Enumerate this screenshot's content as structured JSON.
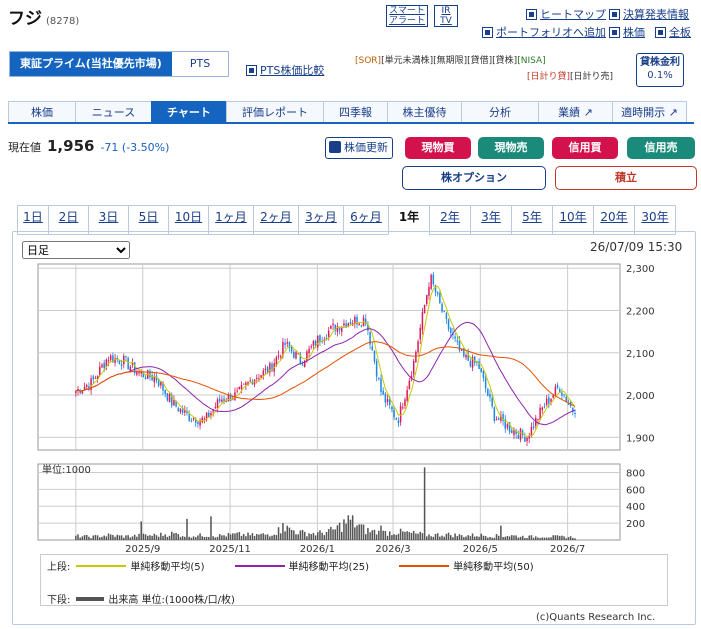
{
  "header": {
    "company": "フジ",
    "code": "(8278)"
  },
  "top_boxes": [
    {
      "line1": "スマート",
      "line2": "アラート"
    },
    {
      "line1": "IR",
      "line2": "TV"
    }
  ],
  "top_links": [
    "ヒートマップ",
    "決算発表情報",
    "ポートフォリオへ追加",
    "株価",
    "全板"
  ],
  "market": {
    "primary": "東証プライム(当社優先市場)",
    "pts": "PTS",
    "pts_compare": "PTS株価比較"
  },
  "tags_row1": [
    "[SOR]",
    "[単元未満株]",
    "[無期限]",
    "[貸借]",
    "[貸株]",
    "[NISA]"
  ],
  "tags_row2": [
    "[日計り貸]",
    "[日計り売]"
  ],
  "lending": {
    "label": "貸株金利",
    "rate": "0.1%"
  },
  "nav_tabs": [
    "株価",
    "ニュース",
    "チャート",
    "評価レポート",
    "四季報",
    "株主優待",
    "分析",
    "業績",
    "適時開示"
  ],
  "quote": {
    "label": "現在値",
    "price": "1,956",
    "change": "-71 (-3.50%)"
  },
  "actions": {
    "refresh": "株価更新",
    "spot_buy": "現物買",
    "spot_sell": "現物売",
    "margin_buy": "信用買",
    "margin_sell": "信用売",
    "option": "株オプション",
    "accumulate": "積立"
  },
  "periods": [
    "1日",
    "2日",
    "3日",
    "5日",
    "10日",
    "1ヶ月",
    "2ヶ月",
    "3ヶ月",
    "6ヶ月",
    "1年",
    "2年",
    "3年",
    "5年",
    "10年",
    "20年",
    "30年"
  ],
  "chart_controls": {
    "interval": "日足",
    "timestamp": "26/07/09 15:30"
  },
  "legend": {
    "upper_label": "上段:",
    "lower_label": "下段:",
    "ma5": "単純移動平均(5)",
    "ma25": "単純移動平均(25)",
    "ma50": "単純移動平均(50)",
    "volume": "出来高 単位:(1000株/口/枚)"
  },
  "copyright": "(c)Quants Research Inc.",
  "colors": {
    "accent": "#1565c0",
    "up": "#d81b60",
    "down": "#1e88e5",
    "ma5": "#c8c800",
    "ma25": "#8e24aa",
    "ma50": "#e65100"
  },
  "chart_data": {
    "type": "candlestick",
    "price_yticks": [
      1900,
      2000,
      2100,
      2200,
      2300
    ],
    "price_ylim": [
      1870,
      2310
    ],
    "volume_yticks": [
      200,
      400,
      600,
      800
    ],
    "volume_ylim": [
      0,
      900
    ],
    "volume_unit_label": "単位:1000",
    "xticks": [
      "2025/9",
      "2025/11",
      "2026/1",
      "2026/3",
      "2026/5",
      "2026/7"
    ],
    "close_keypoints": [
      2010,
      2030,
      2090,
      2080,
      2050,
      2040,
      1980,
      1950,
      1940,
      1990,
      2000,
      2040,
      2060,
      2120,
      2080,
      2130,
      2160,
      2175,
      2180,
      2000,
      1940,
      2080,
      2280,
      2170,
      2090,
      2070,
      1950,
      1920,
      1900,
      1970,
      2020,
      1956
    ],
    "volume_keypoints": [
      50,
      40,
      60,
      45,
      55,
      60,
      80,
      50,
      60,
      55,
      70,
      60,
      70,
      150,
      90,
      80,
      120,
      250,
      120,
      90,
      100,
      80,
      60,
      70,
      55,
      60,
      50,
      55,
      40,
      45,
      40,
      35
    ],
    "volume_spikes": [
      {
        "i": 30,
        "v": 220
      },
      {
        "i": 51,
        "v": 250
      },
      {
        "i": 62,
        "v": 280
      },
      {
        "i": 95,
        "v": 200
      },
      {
        "i": 140,
        "v": 170
      },
      {
        "i": 160,
        "v": 860
      },
      {
        "i": 195,
        "v": 170
      }
    ]
  }
}
